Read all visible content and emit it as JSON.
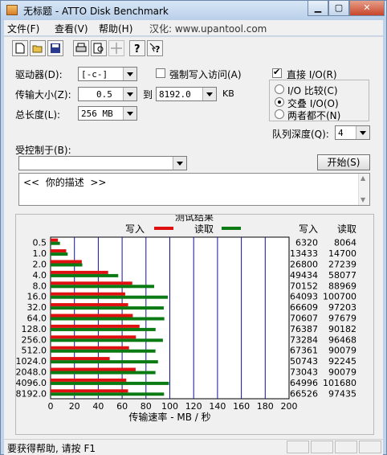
{
  "window": {
    "title": "无标题 - ATTO Disk Benchmark"
  },
  "menu": {
    "file": "文件(F)",
    "view": "查看(V)",
    "help": "帮助(H)",
    "info": "汉化: www.upantool.com"
  },
  "form": {
    "drive_label": "驱动器(D):",
    "drive_value": "[-c-]",
    "force_write_label": "强制写入访问(A)",
    "force_write_checked": false,
    "transfer_label": "传输大小(Z):",
    "transfer_from": "0.5",
    "transfer_to_label": "到",
    "transfer_to": "8192.0",
    "transfer_unit": "KB",
    "length_label": "总长度(L):",
    "length_value": "256 MB",
    "direct_io_label": "直接 I/O(R)",
    "direct_io_checked": true,
    "io_compare_label": "I/O 比较(C)",
    "overlapped_io_label": "交叠 I/O(O)",
    "neither_label": "两者都不(N)",
    "selected_io": "overlapped",
    "queue_label": "队列深度(Q):",
    "queue_value": "4",
    "controlled_label": "受控制于(B):",
    "controlled_value": "",
    "start_button": "开始(S)",
    "description": "<<  你的描述  >>"
  },
  "results": {
    "title": "测试结果",
    "write_legend": "写入",
    "read_legend": "读取",
    "write_header": "写入",
    "read_header": "读取",
    "x_axis_label": "传输速率 - MB / 秒",
    "colors": {
      "write": "#e01010",
      "read": "#0a7a12",
      "grid": "#1010a0"
    }
  },
  "chart_data": {
    "type": "bar",
    "orientation": "horizontal",
    "categories": [
      "0.5",
      "1.0",
      "2.0",
      "4.0",
      "8.0",
      "16.0",
      "32.0",
      "64.0",
      "128.0",
      "256.0",
      "512.0",
      "1024.0",
      "2048.0",
      "4096.0",
      "8192.0"
    ],
    "series": [
      {
        "name": "写入",
        "values": [
          6320,
          13433,
          26800,
          49434,
          70152,
          64093,
          66609,
          70607,
          76387,
          73284,
          67361,
          50743,
          73043,
          64996,
          66526
        ]
      },
      {
        "name": "读取",
        "values": [
          8064,
          14700,
          27239,
          58077,
          88969,
          100700,
          97203,
          97679,
          90182,
          96468,
          90079,
          92245,
          90079,
          101680,
          97435
        ]
      }
    ],
    "xlabel": "传输速率 - MB / 秒",
    "xlim": [
      0,
      200
    ],
    "xticks": [
      0,
      20,
      40,
      60,
      80,
      100,
      120,
      140,
      160,
      180,
      200
    ],
    "grid": true,
    "legend": "top"
  },
  "status": {
    "text": "要获得帮助, 请按 F1"
  }
}
